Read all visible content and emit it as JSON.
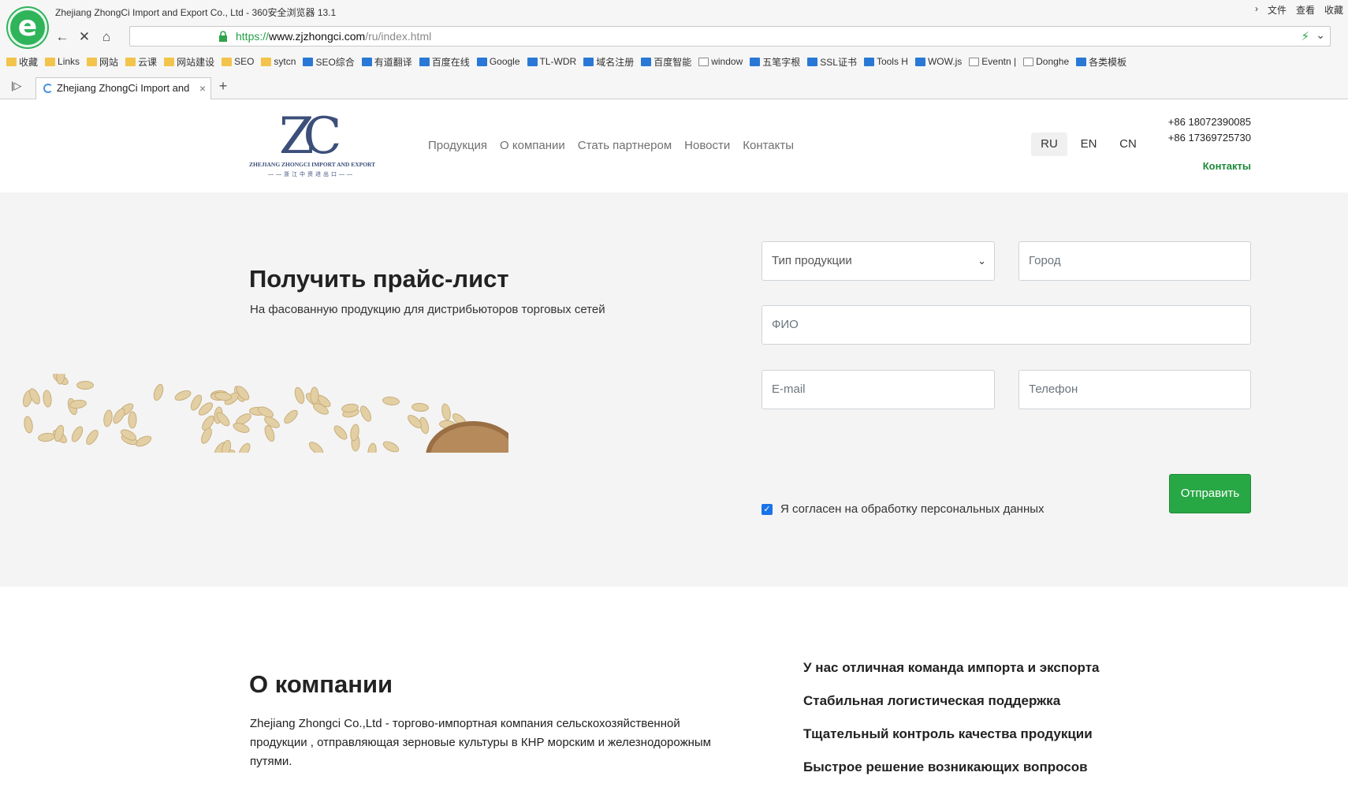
{
  "browser": {
    "window_title": "Zhejiang ZhongCi Import and Export Co., Ltd - 360安全浏览器 13.1",
    "menu": [
      "文件",
      "查看",
      "收藏"
    ],
    "url_scheme": "https://",
    "url_host": "www.zjzhongci.com",
    "url_path": "/ru/index.html",
    "bookmarks": [
      {
        "label": "收藏",
        "icon": "star-icon"
      },
      {
        "label": "Links",
        "icon": "folder-icon"
      },
      {
        "label": "网站",
        "icon": "folder-icon"
      },
      {
        "label": "云课",
        "icon": "folder-icon"
      },
      {
        "label": "网站建设",
        "icon": "folder-icon"
      },
      {
        "label": "SEO",
        "icon": "folder-icon"
      },
      {
        "label": "sytcn",
        "icon": "folder-icon"
      },
      {
        "label": "SEO综合",
        "icon": "site-icon"
      },
      {
        "label": "有道翻译",
        "icon": "site-icon"
      },
      {
        "label": "百度在线",
        "icon": "site-icon"
      },
      {
        "label": "Google",
        "icon": "site-icon"
      },
      {
        "label": "TL-WDR",
        "icon": "site-icon"
      },
      {
        "label": "域名注册",
        "icon": "site-icon"
      },
      {
        "label": "百度智能",
        "icon": "site-icon"
      },
      {
        "label": "window",
        "icon": "page-icon"
      },
      {
        "label": "五笔字根",
        "icon": "site-icon"
      },
      {
        "label": "SSL证书",
        "icon": "site-icon"
      },
      {
        "label": "Tools H",
        "icon": "site-icon"
      },
      {
        "label": "WOW.js",
        "icon": "site-icon"
      },
      {
        "label": "Eventn |",
        "icon": "page-icon"
      },
      {
        "label": "Donghe",
        "icon": "page-icon"
      },
      {
        "label": "各类模板",
        "icon": "site-icon"
      }
    ],
    "tab_title": "Zhejiang ZhongCi Import and",
    "tab_close": "×",
    "new_tab": "+"
  },
  "header": {
    "logo_letters": "ZC",
    "logo_name": "ZHEJIANG ZHONGCI IMPORT AND EXPORT",
    "logo_sub": "——浙江中资进出口——",
    "nav": [
      "Продукция",
      "О компании",
      "Стать партнером",
      "Новости",
      "Контакты"
    ],
    "languages": [
      "RU",
      "EN",
      "CN"
    ],
    "active_language": "RU",
    "phones": [
      "+86 18072390085",
      "+86 17369725730"
    ],
    "contacts_link": "Контакты"
  },
  "price": {
    "title": "Получить прайс-лист",
    "subtitle": "На фасованную продукцию для дистрибьюторов торговых сетей",
    "product_type": "Тип продукции",
    "city_placeholder": "Город",
    "name_placeholder": "ФИО",
    "email_placeholder": "E-mail",
    "phone_placeholder": "Телефон",
    "consent": "Я согласен на обработку персональных данных",
    "submit": "Отправить"
  },
  "about": {
    "title": "О компании",
    "text": "Zhejiang Zhongci Co.,Ltd - торгово-импортная компания сельскохозяйственной продукции , отправляющая зерновые культуры в КНР морским и железнодорожным путями.",
    "points": [
      "У нас отличная команда импорта и экспорта",
      "Стабильная логистическая поддержка",
      "Тщательный контроль качества продукции",
      "Быстрое решение возникающих вопросов"
    ]
  },
  "colors": {
    "accent": "#28a745",
    "link": "#1d8a3a",
    "logo": "#3c4f7a"
  }
}
